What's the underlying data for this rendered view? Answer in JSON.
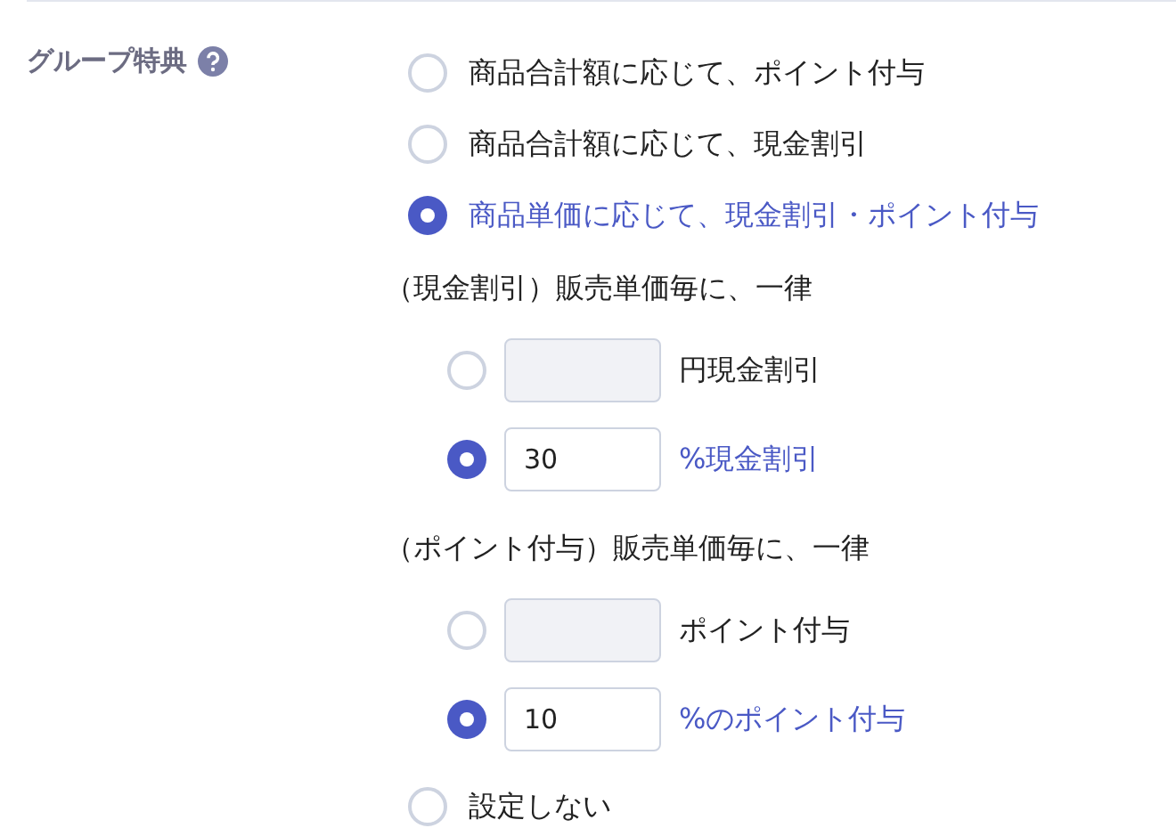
{
  "field": {
    "label": "グループ特典"
  },
  "options": [
    {
      "label": "商品合計額に応じて、ポイント付与",
      "selected": false
    },
    {
      "label": "商品合計額に応じて、現金割引",
      "selected": false
    },
    {
      "label": "商品単価に応じて、現金割引・ポイント付与",
      "selected": true,
      "sections": [
        {
          "heading": "（現金割引）販売単価毎に、一律",
          "choices": [
            {
              "selected": false,
              "unit": "円現金割引"
            },
            {
              "selected": true,
              "value": "30",
              "unit": "%現金割引"
            }
          ]
        },
        {
          "heading": "（ポイント付与）販売単価毎に、一律",
          "choices": [
            {
              "selected": false,
              "unit": "ポイント付与"
            },
            {
              "selected": true,
              "value": "10",
              "unit": "%のポイント付与"
            }
          ]
        }
      ]
    },
    {
      "label": "設定しない",
      "selected": false
    }
  ]
}
